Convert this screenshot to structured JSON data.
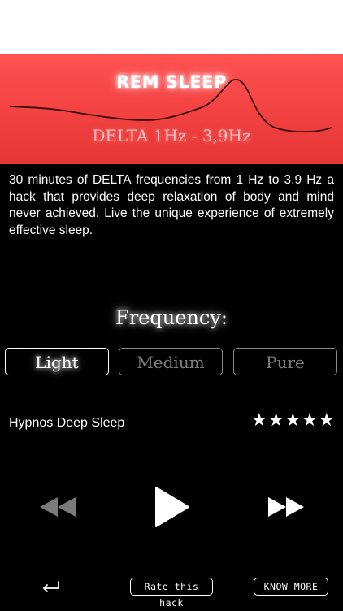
{
  "banner": {
    "title": "REM SLEEP",
    "subtitle": "DELTA 1Hz - 3,9Hz"
  },
  "description": "30 minutes of DELTA frequencies from 1 Hz to 3.9 Hz a hack that provides deep relaxation of body and mind never achieved. Live the unique experience of extremely effective sleep.",
  "frequency": {
    "title": "Frequency:",
    "options": [
      "Light",
      "Medium",
      "Pure"
    ],
    "selected": "Light"
  },
  "track": {
    "name": "Hypnos Deep Sleep",
    "rating_stars": "★★★★★",
    "rating_value": 5,
    "rating_max": 5
  },
  "footer": {
    "rate_label": "Rate this hack",
    "know_more_label": "KNOW MORE"
  },
  "icons": {
    "back": "return-arrow-icon",
    "rewind": "rewind-icon",
    "play": "play-icon",
    "forward": "fast-forward-icon"
  },
  "colors": {
    "banner_red": "#f24141",
    "background": "#000000",
    "inactive_text": "#7d7d7d"
  }
}
